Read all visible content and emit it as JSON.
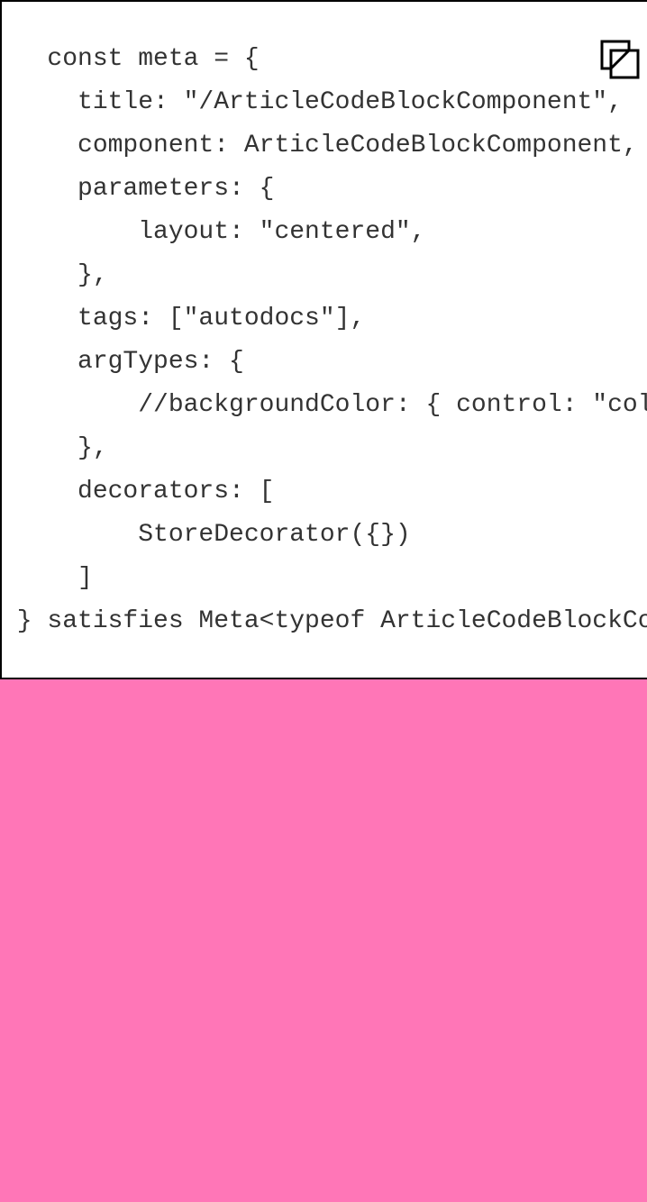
{
  "colors": {
    "background": "#ff76b7",
    "code_block_background": "#ffffff",
    "code_block_border": "#000000",
    "code_text": "#333333"
  },
  "code_block": {
    "copy_icon": "copy-icon",
    "lines": [
      "   const meta = {",
      "     title: \"/ArticleCodeBlockComponent\",",
      "     component: ArticleCodeBlockComponent,",
      "     parameters: {",
      "         layout: \"centered\",",
      "     },",
      "     tags: [\"autodocs\"],",
      "     argTypes: {",
      "         //backgroundColor: { control: \"color\" },",
      "     },",
      "     decorators: [",
      "         StoreDecorator({})",
      "     ]",
      " } satisfies Meta<typeof ArticleCodeBlockComponent>;"
    ]
  }
}
